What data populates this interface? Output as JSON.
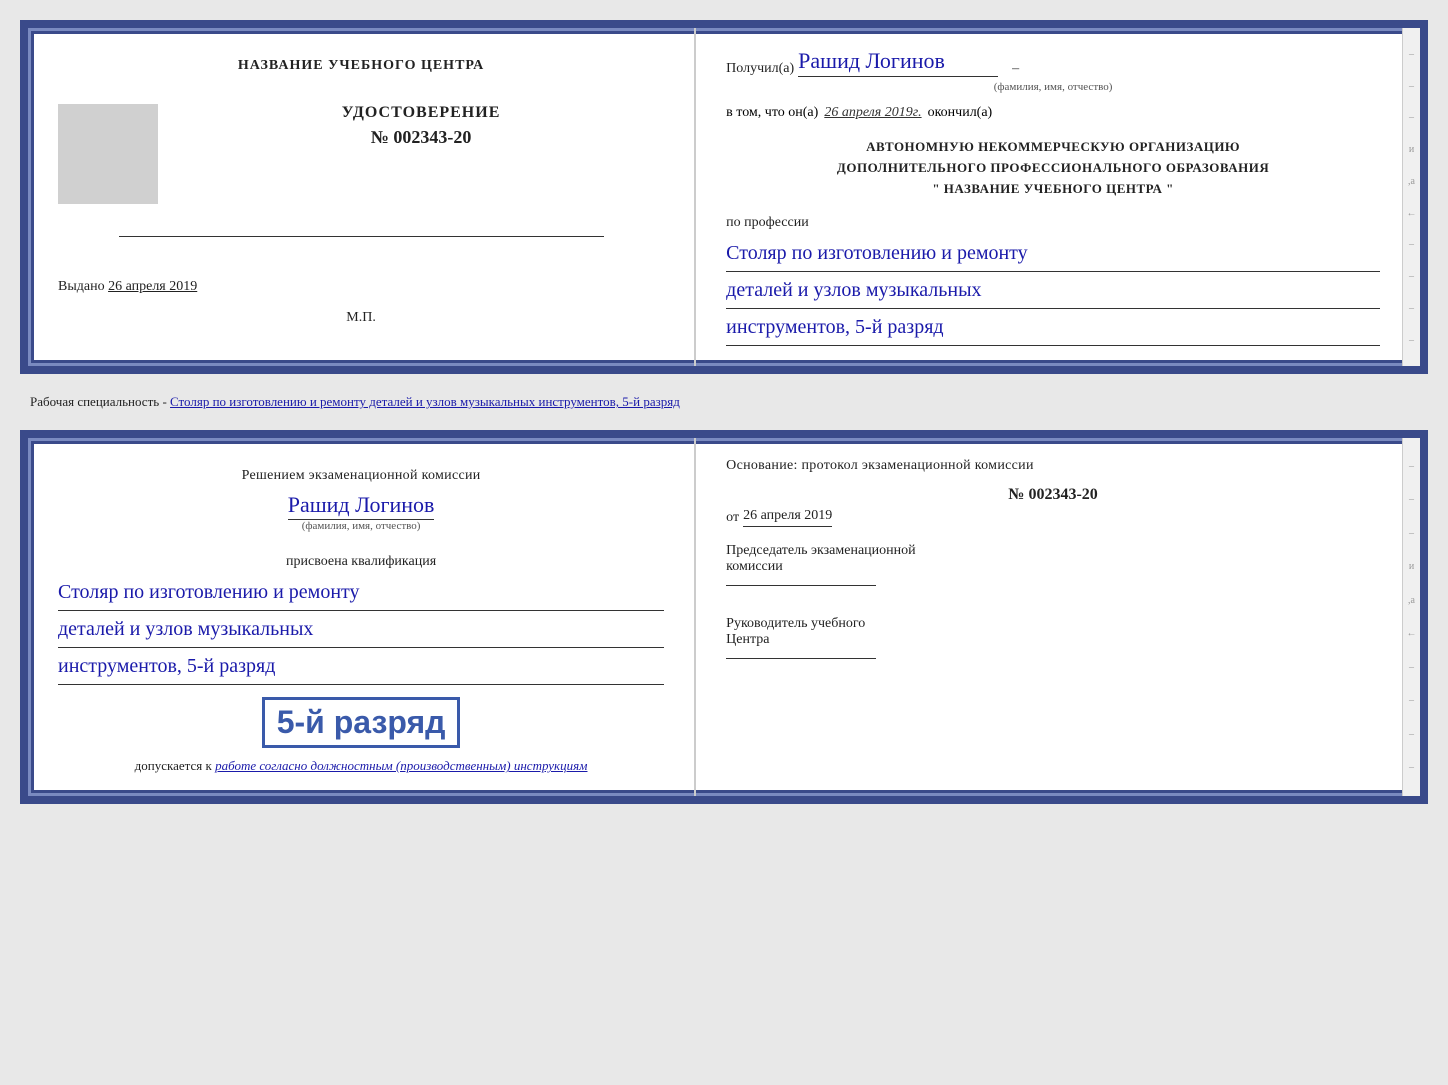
{
  "top_cert": {
    "left": {
      "center_name": "НАЗВАНИЕ УЧЕБНОГО ЦЕНТРА",
      "udostoverenie_label": "УДОСТОВЕРЕНИЕ",
      "cert_no_prefix": "№",
      "cert_no": "002343-20",
      "issued_label": "Выдано",
      "issued_date": "26 апреля 2019",
      "mp_label": "М.П."
    },
    "right": {
      "poluchil_prefix": "Получил(а)",
      "recipient_name": "Рашид Логинов",
      "fio_subtitle": "(фамилия, имя, отчество)",
      "vtom_prefix": "в том, что он(а)",
      "completion_date": "26 апреля 2019г.",
      "okonchil": "окончил(а)",
      "org_line1": "АВТОНОМНУЮ НЕКОММЕРЧЕСКУЮ ОРГАНИЗАЦИЮ",
      "org_line2": "ДОПОЛНИТЕЛЬНОГО ПРОФЕССИОНАЛЬНОГО ОБРАЗОВАНИЯ",
      "org_line3": "\"  НАЗВАНИЕ УЧЕБНОГО ЦЕНТРА   \"",
      "po_professii": "по профессии",
      "profession_line1": "Столяр по изготовлению и ремонту",
      "profession_line2": "деталей и узлов музыкальных",
      "profession_line3": "инструментов, 5-й разряд"
    }
  },
  "separator": {
    "text": "Рабочая специальность - Столяр по изготовлению и ремонту деталей и узлов музыкальных инструментов, 5-й разряд"
  },
  "bottom_cert": {
    "left": {
      "resheniem_text": "Решением  экзаменационной  комиссии",
      "recipient_name": "Рашид Логинов",
      "fio_subtitle": "(фамилия, имя, отчество)",
      "prisvoyena_label": "присвоена квалификация",
      "profession_line1": "Столяр по изготовлению и ремонту",
      "profession_line2": "деталей и узлов музыкальных",
      "profession_line3": "инструментов, 5-й разряд",
      "razryad_big": "5-й разряд",
      "dopuskaetsya_prefix": "допускается к",
      "dopuskaetsya_italic": "работе согласно должностным (производственным) инструкциям"
    },
    "right": {
      "osnovanie_text": "Основание: протокол экзаменационной  комиссии",
      "no_prefix": "№",
      "protocol_no": "002343-20",
      "ot_prefix": "от",
      "protocol_date": "26 апреля 2019",
      "predsedatel_line1": "Председатель экзаменационной",
      "predsedatel_line2": "комиссии",
      "rukovoditel_line1": "Руководитель учебного",
      "rukovoditel_line2": "Центра"
    }
  },
  "decorations": {
    "right_marks": [
      "–",
      "–",
      "–",
      "и",
      ",а",
      "←",
      "–",
      "–",
      "–",
      "–"
    ]
  }
}
